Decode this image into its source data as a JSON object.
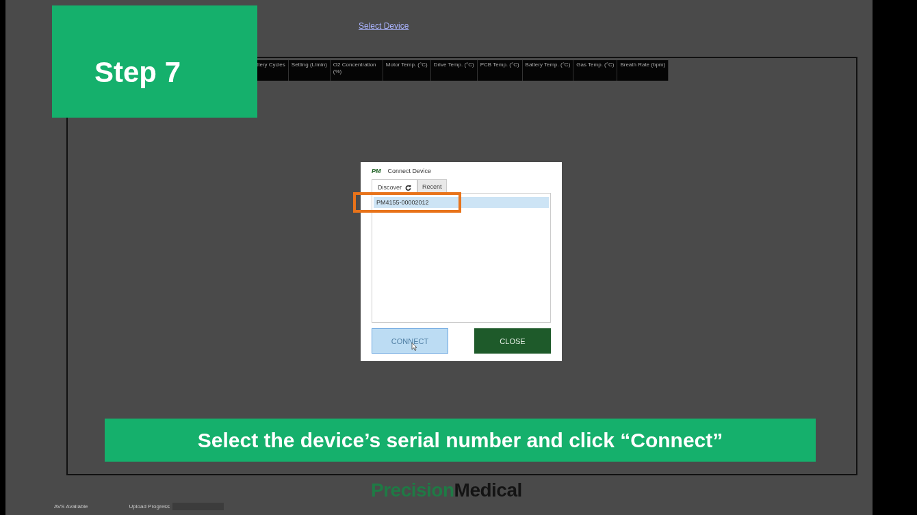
{
  "app": {
    "link": "Select Device",
    "table": {
      "columns": [
        "ttery Cycles",
        "Setting (L/min)",
        "O2 Concentration (%)",
        "Motor Temp. (°C)",
        "Drive Temp. (°C)",
        "PCB Temp. (°C)",
        "Battery Temp. (°C)",
        "Gas Temp. (°C)",
        "Breath Rate (bpm)"
      ]
    },
    "footer": {
      "logo": {
        "brand": "Precision",
        "suffix": "Medical"
      },
      "status": "AVS Available",
      "upload": {
        "label": "Upload Progress",
        "level": 0
      }
    }
  },
  "dialog": {
    "logo": "PM",
    "title": "Connect Device",
    "tabs": [
      {
        "label": "Discover",
        "selected": true,
        "refresh": true
      },
      {
        "label": "Recent",
        "selected": false,
        "refresh": false
      }
    ],
    "devices": [
      {
        "serial": "PM4155-00002012",
        "selected": true,
        "highlighted": true
      }
    ],
    "buttons": [
      {
        "label": "CONNECT",
        "kind": "primary",
        "disabled": true
      },
      {
        "label": "CLOSE",
        "kind": "secondary",
        "disabled": false
      }
    ]
  },
  "overlay": {
    "step": "Step 7",
    "caption": "Select the device’s serial number and click “Connect”"
  }
}
